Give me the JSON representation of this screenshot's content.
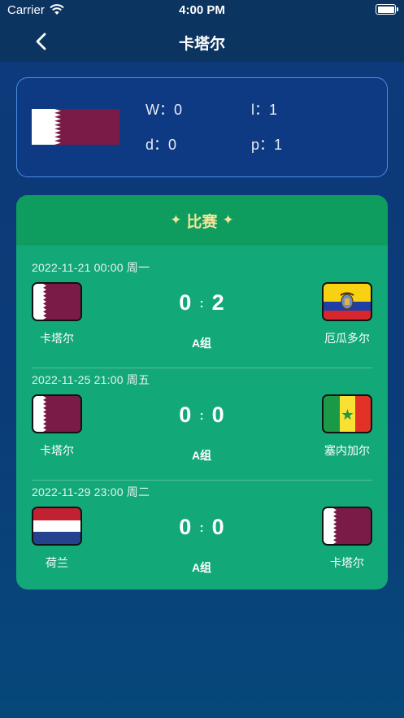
{
  "status": {
    "carrier": "Carrier",
    "time": "4:00 PM"
  },
  "nav": {
    "title": "卡塔尔"
  },
  "colors": {
    "accent_gold": "#f4e39a",
    "card_green": "#13a878",
    "header_green": "#0e9d5e"
  },
  "stats": {
    "w": "W：0",
    "l": "l：1",
    "d": "d：0",
    "p": "p：1"
  },
  "matches_section": {
    "title": "比赛",
    "icon": "sparkle-icon"
  },
  "matches": [
    {
      "date": "2022-11-21 00:00 周一",
      "home": "卡塔尔",
      "home_score": "0",
      "away_score": "2",
      "away": "厄瓜多尔",
      "group": "A组"
    },
    {
      "date": "2022-11-25 21:00 周五",
      "home": "卡塔尔",
      "home_score": "0",
      "away_score": "0",
      "away": "塞内加尔",
      "group": "A组"
    },
    {
      "date": "2022-11-29 23:00 周二",
      "home": "荷兰",
      "home_score": "0",
      "away_score": "0",
      "away": "卡塔尔",
      "group": "A组"
    }
  ]
}
